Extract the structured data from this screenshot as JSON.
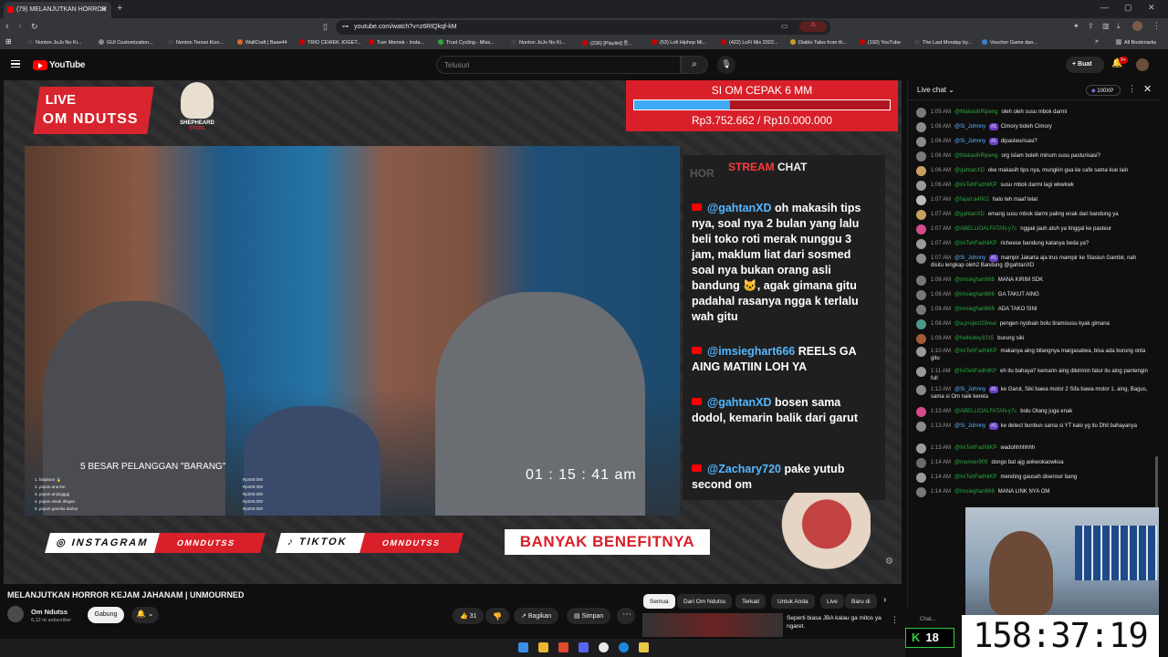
{
  "browser": {
    "tab_title": "(79) MELANJUTKAN HORROR",
    "url": "youtube.com/watch?v=z6RtQkqf-kM",
    "bookmarks": [
      {
        "label": "Nonton JoJo No Ki...",
        "color": "#444444"
      },
      {
        "label": "GUI Customization...",
        "color": "#888888"
      },
      {
        "label": "Nonton Tensei Kizo...",
        "color": "#444444"
      },
      {
        "label": "WallCraft | Base44",
        "color": "#e0662a"
      },
      {
        "label": "TRIO CEWEK JOGET...",
        "color": "#cc0000"
      },
      {
        "label": "Tuer Memek - Insta...",
        "color": "#cc0000"
      },
      {
        "label": "Trust Cycling - Miss...",
        "color": "#2ba640"
      },
      {
        "label": "Nonton JoJo No Ki...",
        "color": "#444444"
      },
      {
        "label": "(236) [Playlist] 동...",
        "color": "#cc0000"
      },
      {
        "label": "(53) Lofi Hiphop Mi...",
        "color": "#cc0000"
      },
      {
        "label": "(422) LoFi Mix 2022...",
        "color": "#cc0000"
      },
      {
        "label": "Diablo Tales from th...",
        "color": "#c8a028"
      },
      {
        "label": "(192) YouTube",
        "color": "#cc0000"
      },
      {
        "label": "The Last Monday by...",
        "color": "#444444"
      },
      {
        "label": "Voucher Game dan...",
        "color": "#3a7ed8"
      }
    ],
    "all_bookmarks": "All Bookmarks"
  },
  "youtube": {
    "logo_text": "YouTube",
    "search_placeholder": "Telusuri",
    "create_label": "Buat",
    "notif_count": "9+"
  },
  "stream": {
    "live_label": "LIVE",
    "channel_banner": "OM NDUTSS",
    "sponsor": "SHEPHEARD",
    "sponsor_sub": "STORE",
    "goal_title": "SI OM CEPAK 6 MM",
    "goal_amount": "Rp3.752.662 / Rp10.000.000",
    "goal_progress": 0.375,
    "overlay_hor": "HOR",
    "stream_chat_a": "STREAM",
    "stream_chat_b": "CHAT",
    "overlay_messages": [
      {
        "user": "@gahtanXD",
        "text": " oh makasih tips nya, soal nya 2 bulan yang lalu beli toko roti merak nunggu 3 jam, maklum liat dari sosmed soal nya bukan orang asli bandung 🐱, agak gimana gitu padahal rasanya ngga k terlalu wah gitu"
      },
      {
        "user": "@imsieghart666",
        "text": " REELS GA AING MATIIN LOH YA"
      },
      {
        "user": "@gahtanXD",
        "text": " bosen sama dodol, kemarin balik dari garut"
      },
      {
        "user": "@Zachary720",
        "text": " pake yutub second om"
      }
    ],
    "clock": "01 : 15 : 41 am",
    "top5_title": "5 BESAR PELANGGAN \"BARANG\"",
    "top5": [
      {
        "name": "1. fatqiraxn 🥇",
        "amt": "Rp400.000"
      },
      {
        "name": "2. popon ana km",
        "amt": "Rp400.000"
      },
      {
        "name": "3. popon anjingggg",
        "amt": "Rp200.000"
      },
      {
        "name": "4. popon sinuk dingan",
        "amt": "Rp200.000"
      },
      {
        "name": "5. popon ganeka darbor",
        "amt": "Rp200.000"
      }
    ],
    "instagram_label": "INSTAGRAM",
    "instagram_handle": "OMNDUTSS",
    "tiktok_label": "TIKTOK",
    "tiktok_handle": "OMNDUTSS",
    "benefit": "BANYAK BENEFITNYA"
  },
  "video": {
    "title": "MELANJUTKAN HORROR KEJAM JAHANAM | UNMOURNED",
    "channel": "Om Ndutss",
    "subs": "6,12 rb subscriber",
    "join": "Gabung",
    "likes": "31",
    "share": "Bagikan",
    "save": "Simpan"
  },
  "chips": [
    "Semua",
    "Dari Om Ndutss",
    "Terkait",
    "Untuk Anda",
    "Live",
    "Baru di"
  ],
  "recommendation": {
    "title": "Seperti biasa JBA kalau ga mitos ya ngaret."
  },
  "live_chat": {
    "title": "Live chat",
    "xp": "100XP",
    "footer": "Chat...",
    "messages": [
      {
        "ts": "1:05 AM",
        "name": "@MakasihRipeng",
        "badge": "",
        "text": "oleh oleh susu mbok darmi",
        "av": "#7a7a7a",
        "blue": false
      },
      {
        "ts": "1:06 AM",
        "name": "@Si_Johnny",
        "badge": "#1",
        "text": "Cimory boleh Cimory",
        "av": "#8a8a8a",
        "blue": true
      },
      {
        "ts": "1:06 AM",
        "name": "@Si_Johnny",
        "badge": "#1",
        "text": "dipasteurisasi?",
        "av": "#8a8a8a",
        "blue": true
      },
      {
        "ts": "1:06 AM",
        "name": "@MakasihRipeng",
        "badge": "",
        "text": "org islam boleh minum susu pasturisasi?",
        "av": "#7a7a7a",
        "blue": false
      },
      {
        "ts": "1:06 AM",
        "name": "@gahtanXD",
        "badge": "",
        "text": "oke makasih tips nya, mungkin gua ke cafe sama kue lain",
        "av": "#c8a060",
        "blue": false
      },
      {
        "ts": "1:06 AM",
        "name": "@IniTehFadhilKP",
        "badge": "",
        "text": "susu mbok darmi lagi wkwkwk",
        "av": "#9a9a9a",
        "blue": false
      },
      {
        "ts": "1:07 AM",
        "name": "@fajarr.a4002",
        "badge": "",
        "text": "halo teh maaf telat",
        "av": "#bbbbbb",
        "blue": false
      },
      {
        "ts": "1:07 AM",
        "name": "@gahtanXD",
        "badge": "",
        "text": "emang susu mbok darmi paling enak dari bandung ya",
        "av": "#c8a060",
        "blue": false
      },
      {
        "ts": "1:07 AM",
        "name": "@ABELLIOALFATAN-y7c",
        "badge": "",
        "text": "nggak jauh atuh ya tinggal ke pasteur",
        "av": "#d64a8a",
        "blue": false
      },
      {
        "ts": "1:07 AM",
        "name": "@IniTehFadhilKP",
        "badge": "",
        "text": "richeese bandung katanya beda ya?",
        "av": "#9a9a9a",
        "blue": false
      },
      {
        "ts": "1:07 AM",
        "name": "@Si_Johnny",
        "badge": "#1",
        "text": "mampir Jakarta aja trus mampir ke Stasiun Gambir, nah disitu lengkap oleh2 Bandung @gahtanXD",
        "av": "#8a8a8a",
        "blue": true
      },
      {
        "ts": "1:08 AM",
        "name": "@imsieghart666",
        "badge": "",
        "text": "MANA KIRIM SDK",
        "av": "#777777",
        "blue": false
      },
      {
        "ts": "1:08 AM",
        "name": "@imsieghart666",
        "badge": "",
        "text": "GA TAKUT AING",
        "av": "#777777",
        "blue": false
      },
      {
        "ts": "1:08 AM",
        "name": "@imsieghart666",
        "badge": "",
        "text": "ADA TAKO SINI",
        "av": "#777777",
        "blue": false
      },
      {
        "ts": "1:08 AM",
        "name": "@a.project29real",
        "badge": "",
        "text": "pengen nyobain bolu tiramisusu kyak gimana",
        "av": "#4a9a8a",
        "blue": false
      },
      {
        "ts": "1:09 AM",
        "name": "@hellkotey1015",
        "badge": "",
        "text": "burung siki",
        "av": "#a05a3a",
        "blue": false
      },
      {
        "ts": "1:10 AM",
        "name": "@IniTehFadhilKP",
        "badge": "",
        "text": "makanya aing bilangnya margasatwa, bisa ada burung onta gitu",
        "av": "#9a9a9a",
        "blue": false
      },
      {
        "ts": "1:11 AM",
        "name": "@IniTehFadhilKP",
        "badge": "",
        "text": "eh itu bahaya? kemarin aing dikirimin fatur itu aing pantengin full",
        "av": "#9a9a9a",
        "blue": false
      },
      {
        "ts": "1:12 AM",
        "name": "@Si_Johnny",
        "badge": "#1",
        "text": "ke Garut, Siki bawa motor 2 Sifa bawa motor 1. aing, Bagus, sama si Om naik kereta",
        "av": "#8a8a8a",
        "blue": true
      },
      {
        "ts": "1:13 AM",
        "name": "@ABELLIOALFATAN-y7c",
        "badge": "",
        "text": "bolu Otang juga enak",
        "av": "#d64a8a",
        "blue": false
      },
      {
        "ts": "1:13 AM",
        "name": "@Si_Johnny",
        "badge": "#1",
        "text": "ke detect bunbun sama si YT kalo yg itu Dhil bahayanya",
        "av": "#8a8a8a",
        "blue": true
      },
      {
        "ts": "1:13 AM",
        "name": "@IniTehFadhilKP",
        "badge": "",
        "text": "wadohhhhhhh",
        "av": "#9a9a9a",
        "blue": false
      },
      {
        "ts": "1:14 AM",
        "name": "@manner909",
        "badge": "",
        "text": "dongo bat ajg aokwokaowkoa",
        "av": "#6a6a6a",
        "blue": false
      },
      {
        "ts": "1:14 AM",
        "name": "@IniTehFadhilKP",
        "badge": "",
        "text": "mending gausah disensor bang",
        "av": "#9a9a9a",
        "blue": false
      },
      {
        "ts": "1:14 AM",
        "name": "@imsieghart666",
        "badge": "",
        "text": "MANA LINK NYA OM",
        "av": "#777777",
        "blue": false
      }
    ]
  },
  "obs": {
    "clock": "158:37:19",
    "viewers": "18",
    "viewers_icon": "kick-icon"
  },
  "colors": {
    "yt_red": "#ff0000",
    "overlay_red": "#d9202a",
    "username_blue": "#56b7ff",
    "chat_green": "#2ba640"
  }
}
